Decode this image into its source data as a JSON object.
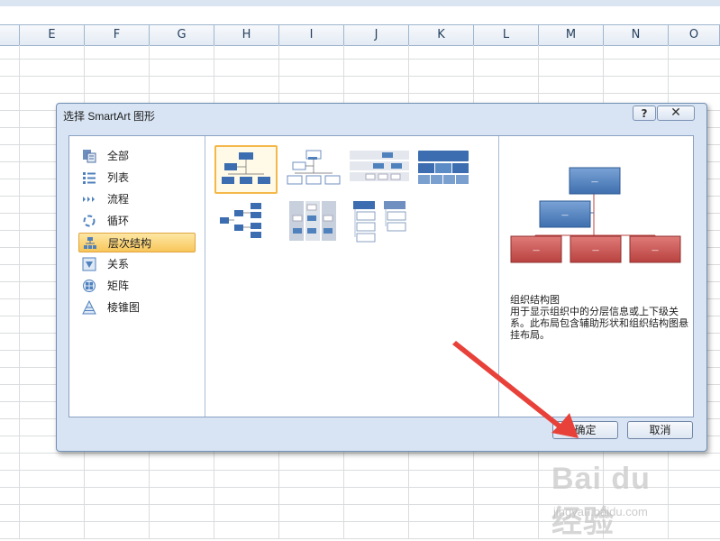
{
  "spreadsheet": {
    "columns": [
      "E",
      "F",
      "G",
      "H",
      "I",
      "J",
      "K",
      "L",
      "M",
      "N",
      "O"
    ]
  },
  "dialog": {
    "title": "选择 SmartArt 图形",
    "help_label": "?",
    "close_label": "✕",
    "categories": [
      {
        "label": "全部",
        "icon": "all-icon",
        "selected": false
      },
      {
        "label": "列表",
        "icon": "list-icon",
        "selected": false
      },
      {
        "label": "流程",
        "icon": "process-icon",
        "selected": false
      },
      {
        "label": "循环",
        "icon": "cycle-icon",
        "selected": false
      },
      {
        "label": "层次结构",
        "icon": "hierarchy-icon",
        "selected": true
      },
      {
        "label": "关系",
        "icon": "relationship-icon",
        "selected": false
      },
      {
        "label": "矩阵",
        "icon": "matrix-icon",
        "selected": false
      },
      {
        "label": "棱锥图",
        "icon": "pyramid-icon",
        "selected": false
      }
    ],
    "layouts": [
      {
        "name": "organization-chart",
        "selected": true
      },
      {
        "name": "name-and-title-org-chart",
        "selected": false
      },
      {
        "name": "hierarchy-layout",
        "selected": false
      },
      {
        "name": "table-hierarchy",
        "selected": false
      },
      {
        "name": "horizontal-hierarchy",
        "selected": false
      },
      {
        "name": "labeled-hierarchy",
        "selected": false
      },
      {
        "name": "hierarchy-list",
        "selected": false
      }
    ],
    "preview": {
      "name": "组织结构图",
      "description": "用于显示组织中的分层信息或上下级关系。此布局包含辅助形状和组织结构图悬挂布局。",
      "node_label": "—"
    },
    "ok_label": "确定",
    "cancel_label": "取消"
  },
  "watermark": {
    "line1": "Bai du 经验",
    "line2": "jingyan.baidu.com"
  },
  "colors": {
    "accent_blue": "#4f81bd",
    "accent_red": "#c0504d",
    "selection_orange": "#f8c65a",
    "arrow_red": "#e8413a"
  }
}
